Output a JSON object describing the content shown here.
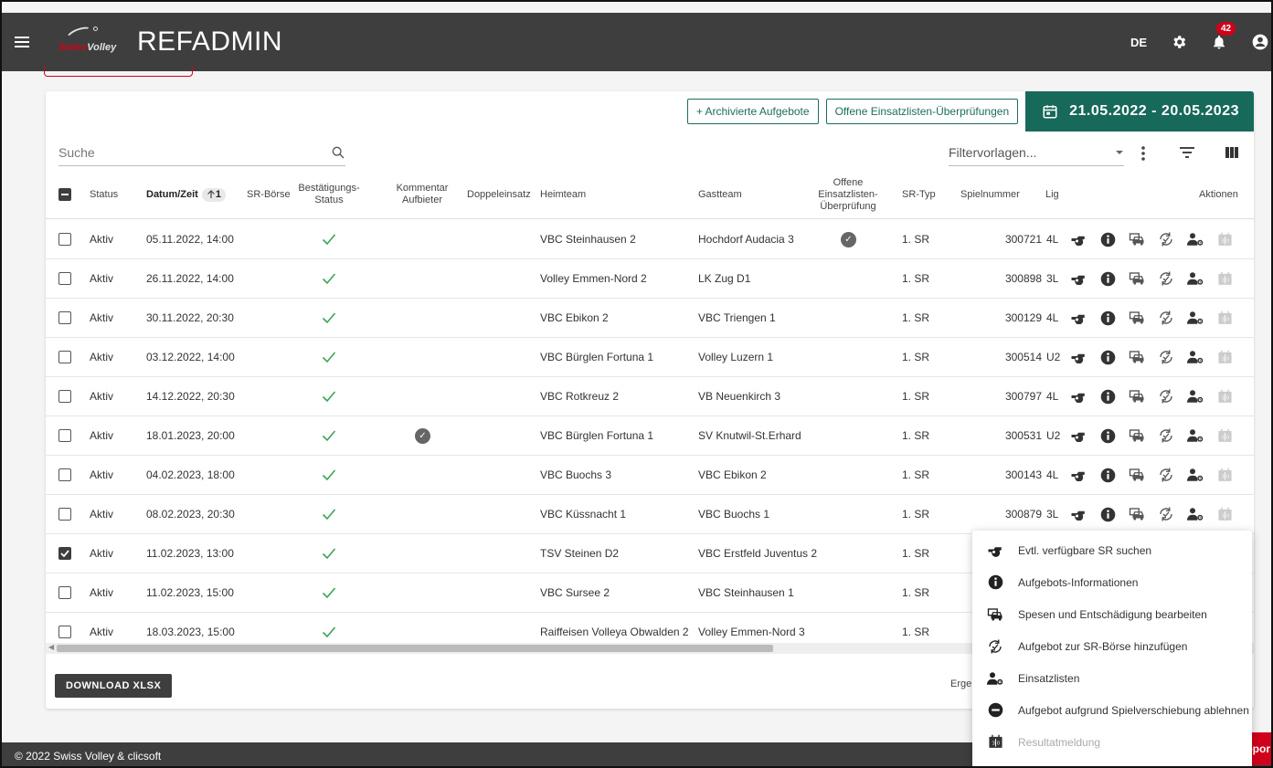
{
  "header": {
    "logo_text_1": "Swiss",
    "logo_text_2": "Volley",
    "title": "REFADMIN",
    "lang": "DE",
    "notifications": "42"
  },
  "toolbar": {
    "archived_label": "+ Archivierte Aufgebote",
    "open_checks_label": "Offene Einsatzlisten-Überprüfungen",
    "date_range": "21.05.2022 - 20.05.2023",
    "search_placeholder": "Suche",
    "filter_placeholder": "Filtervorlagen..."
  },
  "columns": {
    "status": "Status",
    "datum": "Datum/Zeit",
    "sort_indicator": "1",
    "sr_boerse": "SR-Börse",
    "bestaetigung": "Bestätigungs-Status",
    "kommentar": "Kommentar Aufbieter",
    "doppeleinsatz": "Doppeleinsatz",
    "heimteam": "Heimteam",
    "gastteam": "Gastteam",
    "offene": "Offene Einsatzlisten-Überprüfung",
    "sr_typ": "SR-Typ",
    "spielnummer": "Spielnummer",
    "liga": "Lig",
    "aktionen": "Aktionen"
  },
  "rows": [
    {
      "status": "Aktiv",
      "datum": "05.11.2022, 14:00",
      "heim": "VBC Steinhausen 2",
      "gast": "Hochdorf Audacia 3",
      "sr": "1. SR",
      "nr": "300721",
      "liga": "4L",
      "checked": false,
      "kommentar": false,
      "offen": true
    },
    {
      "status": "Aktiv",
      "datum": "26.11.2022, 14:00",
      "heim": "Volley Emmen-Nord 2",
      "gast": "LK Zug D1",
      "sr": "1. SR",
      "nr": "300898",
      "liga": "3L",
      "checked": false,
      "kommentar": false,
      "offen": false
    },
    {
      "status": "Aktiv",
      "datum": "30.11.2022, 20:30",
      "heim": "VBC Ebikon 2",
      "gast": "VBC Triengen 1",
      "sr": "1. SR",
      "nr": "300129",
      "liga": "4L",
      "checked": false,
      "kommentar": false,
      "offen": false
    },
    {
      "status": "Aktiv",
      "datum": "03.12.2022, 14:00",
      "heim": "VBC Bürglen Fortuna 1",
      "gast": "Volley Luzern 1",
      "sr": "1. SR",
      "nr": "300514",
      "liga": "U2",
      "checked": false,
      "kommentar": false,
      "offen": false
    },
    {
      "status": "Aktiv",
      "datum": "14.12.2022, 20:30",
      "heim": "VBC Rotkreuz 2",
      "gast": "VB Neuenkirch 3",
      "sr": "1. SR",
      "nr": "300797",
      "liga": "4L",
      "checked": false,
      "kommentar": false,
      "offen": false
    },
    {
      "status": "Aktiv",
      "datum": "18.01.2023, 20:00",
      "heim": "VBC Bürglen Fortuna 1",
      "gast": "SV Knutwil-St.Erhard",
      "sr": "1. SR",
      "nr": "300531",
      "liga": "U2",
      "checked": false,
      "kommentar": true,
      "offen": false
    },
    {
      "status": "Aktiv",
      "datum": "04.02.2023, 18:00",
      "heim": "VBC Buochs 3",
      "gast": "VBC Ebikon 2",
      "sr": "1. SR",
      "nr": "300143",
      "liga": "4L",
      "checked": false,
      "kommentar": false,
      "offen": false
    },
    {
      "status": "Aktiv",
      "datum": "08.02.2023, 20:30",
      "heim": "VBC Küssnacht 1",
      "gast": "VBC Buochs 1",
      "sr": "1. SR",
      "nr": "300879",
      "liga": "3L",
      "checked": false,
      "kommentar": false,
      "offen": false
    },
    {
      "status": "Aktiv",
      "datum": "11.02.2023, 13:00",
      "heim": "TSV Steinen D2",
      "gast": "VBC Erstfeld Juventus 2",
      "sr": "1. SR",
      "nr": "",
      "liga": "",
      "checked": true,
      "kommentar": false,
      "offen": false
    },
    {
      "status": "Aktiv",
      "datum": "11.02.2023, 15:00",
      "heim": "VBC Sursee 2",
      "gast": "VBC Steinhausen 1",
      "sr": "1. SR",
      "nr": "",
      "liga": "",
      "checked": false,
      "kommentar": false,
      "offen": false
    },
    {
      "status": "Aktiv",
      "datum": "18.03.2023, 15:00",
      "heim": "Raiffeisen Volleya Obwalden 2",
      "gast": "Volley Emmen-Nord 3",
      "sr": "1. SR",
      "nr": "",
      "liga": "",
      "checked": false,
      "kommentar": false,
      "offen": false
    }
  ],
  "footer": {
    "download": "DOWNLOAD XLSX",
    "results_partial": "Ergel",
    "copyright": "© 2022 Swiss Volley & clicsoft",
    "support_partial": "ppor"
  },
  "menu": [
    {
      "label": "Evtl. verfügbare SR suchen",
      "icon": "whistle-icon",
      "disabled": false
    },
    {
      "label": "Aufgebots-Informationen",
      "icon": "info-icon",
      "disabled": false
    },
    {
      "label": "Spesen und Entschädigung bearbeiten",
      "icon": "car-expenses-icon",
      "disabled": false
    },
    {
      "label": "Aufgebot zur SR-Börse hinzufügen",
      "icon": "exchange-icon",
      "disabled": false
    },
    {
      "label": "Einsatzlisten",
      "icon": "user-settings-icon",
      "disabled": false
    },
    {
      "label": "Aufgebot aufgrund Spielverschiebung ablehnen",
      "icon": "minus-circle-icon",
      "disabled": false
    },
    {
      "label": "Resultatmeldung",
      "icon": "scoreboard-icon",
      "disabled": true
    }
  ],
  "colors": {
    "header": "#3e3e3e",
    "accent": "#17695a",
    "check": "#3aa357",
    "brand_red": "#d0021b"
  }
}
